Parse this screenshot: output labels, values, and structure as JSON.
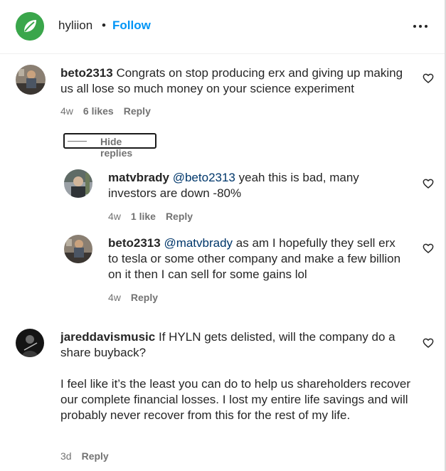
{
  "header": {
    "account": "hyliion",
    "separator": "•",
    "follow_label": "Follow",
    "brand_color": "#3aa64b",
    "link_color": "#0095f6"
  },
  "comments": [
    {
      "username": "beto2313",
      "text": "Congrats on stop producing erx and giving up making us all lose so much money on your science experiment",
      "time": "4w",
      "likes": "6 likes",
      "reply": "Reply",
      "hide_replies": "Hide replies",
      "replies": [
        {
          "username": "matvbrady",
          "mention": "@beto2313",
          "text": "yeah this is bad, many investors are down -80%",
          "time": "4w",
          "likes": "1 like",
          "reply": "Reply"
        },
        {
          "username": "beto2313",
          "mention": "@matvbrady",
          "text": "as am I hopefully they sell erx to tesla or some other company and make a few billion on it then I can sell for some gains lol",
          "time": "4w",
          "reply": "Reply"
        }
      ]
    },
    {
      "username": "jareddavismusic",
      "text": "If HYLN gets delisted, will the company do a share buyback?",
      "text2": "I feel like it’s the least you can do to help us shareholders recover our complete financial losses. I lost my entire life savings and will probably never recover from this for the rest of my life.",
      "time": "3d",
      "reply": "Reply"
    }
  ]
}
